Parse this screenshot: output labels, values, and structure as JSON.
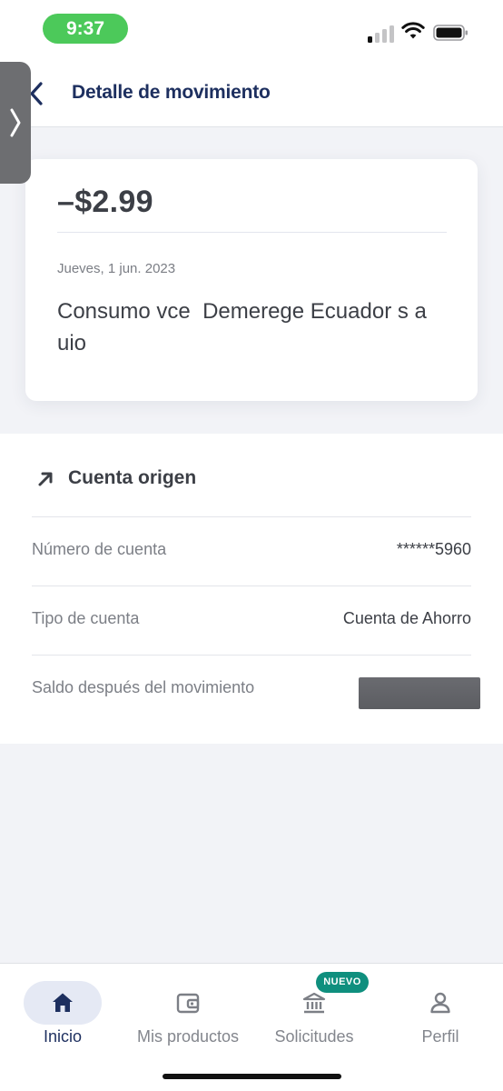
{
  "status_bar": {
    "time": "9:37"
  },
  "header": {
    "title": "Detalle de movimiento"
  },
  "movement": {
    "amount": "–$2.99",
    "date": "Jueves, 1 jun. 2023",
    "description": "Consumo vce  Demerege Ecuador s a uio"
  },
  "account": {
    "section_title": "Cuenta origen",
    "rows": [
      {
        "label": "Número de cuenta",
        "value": "******5960"
      },
      {
        "label": "Tipo de cuenta",
        "value": "Cuenta de Ahorro"
      },
      {
        "label": "Saldo después del movimiento",
        "value": ""
      }
    ]
  },
  "bottom_nav": {
    "items": [
      {
        "label": "Inicio",
        "icon": "home-icon",
        "active": true
      },
      {
        "label": "Mis productos",
        "icon": "wallet-icon",
        "active": false
      },
      {
        "label": "Solicitudes",
        "icon": "bank-icon",
        "active": false,
        "badge": "NUEVO"
      },
      {
        "label": "Perfil",
        "icon": "person-icon",
        "active": false
      }
    ]
  },
  "colors": {
    "brand_navy": "#1d2f5f",
    "badge_teal": "#0f8f7e",
    "time_pill_green": "#4cc95a",
    "background": "#f2f3f7"
  }
}
